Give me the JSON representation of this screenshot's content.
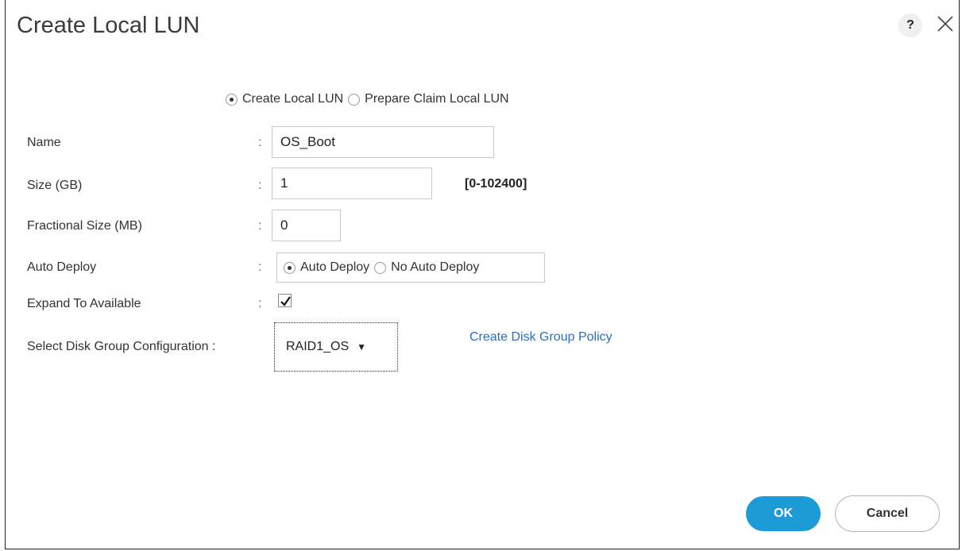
{
  "dialog": {
    "title": "Create Local LUN",
    "help_label": "?"
  },
  "mode": {
    "options": [
      {
        "label": "Create Local LUN",
        "selected": true
      },
      {
        "label": "Prepare Claim Local LUN",
        "selected": false
      }
    ]
  },
  "form": {
    "colon": ":",
    "name": {
      "label": "Name",
      "value": "OS_Boot"
    },
    "size": {
      "label": "Size (GB)",
      "value": "1",
      "hint": "[0-102400]"
    },
    "fractional_size": {
      "label": "Fractional Size (MB)",
      "value": "0"
    },
    "auto_deploy": {
      "label": "Auto Deploy",
      "options": [
        {
          "label": "Auto Deploy",
          "selected": true
        },
        {
          "label": "No Auto Deploy",
          "selected": false
        }
      ]
    },
    "expand_to_available": {
      "label": "Expand To Available",
      "checked": true
    },
    "disk_group": {
      "label": "Select Disk Group Configuration :",
      "value": "RAID1_OS",
      "link": "Create Disk Group Policy"
    }
  },
  "buttons": {
    "ok": "OK",
    "cancel": "Cancel"
  },
  "colors": {
    "accent": "#1d9bd6",
    "link": "#2a6ebb"
  }
}
